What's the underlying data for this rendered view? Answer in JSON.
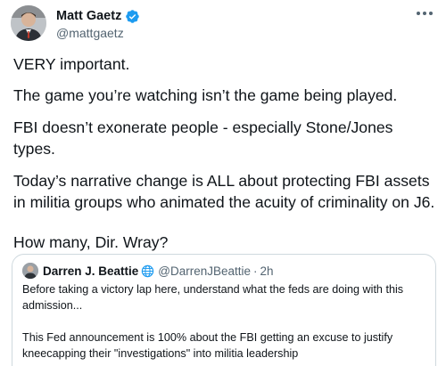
{
  "tweet": {
    "author": {
      "name": "Matt Gaetz",
      "handle": "@mattgaetz",
      "avatar_icon": "person-avatar",
      "verified_icon": "verified-badge-icon",
      "verified_color": "#1d9bf0"
    },
    "more_icon": "more-options-icon",
    "paragraphs": [
      "VERY important.",
      "The game you’re watching isn’t the game being played.",
      "FBI doesn’t exonerate people - especially Stone/Jones types.",
      "Today’s narrative change is ALL about protecting FBI assets in militia groups who animated the acuity of criminality on J6.",
      "How many, Dir. Wray?"
    ]
  },
  "quoted_tweet": {
    "author": {
      "name": "Darren J. Beattie",
      "affiliation_icon": "globe-icon",
      "handle": "@DarrenJBeattie",
      "separator": "·",
      "time": "2h"
    },
    "paragraphs": [
      "Before taking a victory lap here, understand what the feds are doing with this admission...",
      "This Fed announcement is 100% about the FBI getting an excuse to justify kneecapping their \"investigations\" into militia leadership"
    ]
  }
}
